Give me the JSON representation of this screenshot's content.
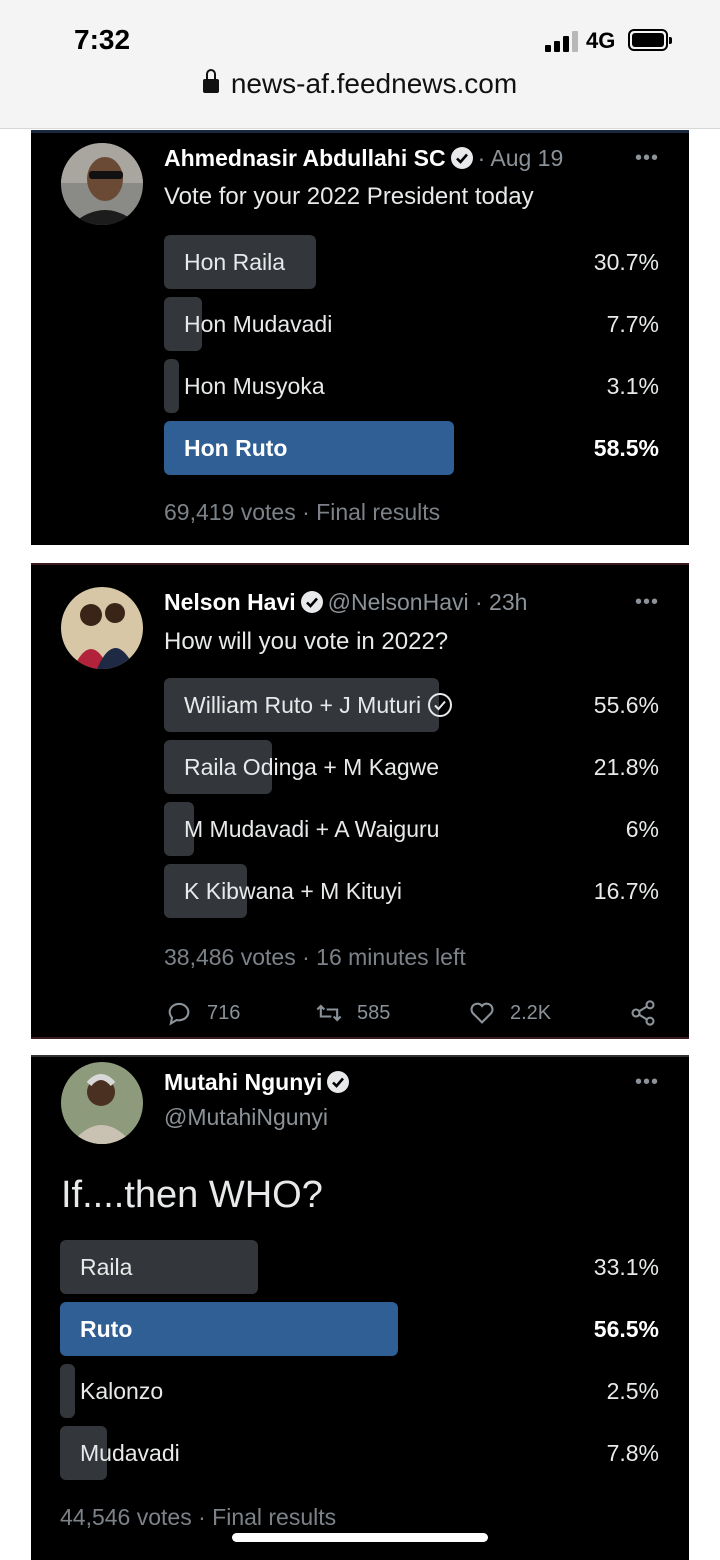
{
  "status_bar": {
    "time": "7:32",
    "network": "4G",
    "url": "news-af.feednews.com"
  },
  "icons": {
    "lock": "lock-icon",
    "verified": "verified-badge-icon",
    "more": "more-options-icon",
    "reply": "reply-icon",
    "retweet": "retweet-icon",
    "like": "heart-icon",
    "share": "share-icon",
    "check": "check-circle-icon"
  },
  "colors": {
    "winner_bar": "#2f5f94",
    "bar": "#33373b",
    "card_bg": "#000000"
  },
  "poll1": {
    "author": "Ahmednasir Abdullahi SC",
    "meta": "· Aug 19",
    "question": "Vote for your 2022 President today",
    "options": [
      {
        "label": "Hon Raila",
        "percent": "30.7%",
        "share": 0.307,
        "winner": false
      },
      {
        "label": "Hon Mudavadi",
        "percent": "7.7%",
        "share": 0.077,
        "winner": false
      },
      {
        "label": "Hon Musyoka",
        "percent": "3.1%",
        "share": 0.031,
        "winner": false
      },
      {
        "label": "Hon Ruto",
        "percent": "58.5%",
        "share": 0.585,
        "winner": true
      }
    ],
    "votes": "69,419 votes",
    "status": "· Final results"
  },
  "poll2": {
    "author": "Nelson Havi",
    "handle": "@NelsonHavi · 23h",
    "question": "How will you vote in 2022?",
    "options": [
      {
        "label": "William Ruto + J Muturi",
        "percent": "55.6%",
        "share": 0.556,
        "selected": true
      },
      {
        "label": "Raila Odinga + M Kagwe",
        "percent": "21.8%",
        "share": 0.218
      },
      {
        "label": "M Mudavadi + A Waiguru",
        "percent": "6%",
        "share": 0.06
      },
      {
        "label": "K Kibwana + M Kituyi",
        "percent": "16.7%",
        "share": 0.167
      }
    ],
    "votes": "38,486 votes",
    "status": "· 16 minutes left",
    "actions": {
      "replies": "716",
      "retweets": "585",
      "likes": "2.2K"
    }
  },
  "poll3": {
    "author": "Mutahi Ngunyi",
    "handle": "@MutahiNgunyi",
    "question": "If....then WHO?",
    "options": [
      {
        "label": "Raila",
        "percent": "33.1%",
        "share": 0.331,
        "winner": false
      },
      {
        "label": "Ruto",
        "percent": "56.5%",
        "share": 0.565,
        "winner": true
      },
      {
        "label": "Kalonzo",
        "percent": "2.5%",
        "share": 0.025,
        "winner": false
      },
      {
        "label": "Mudavadi",
        "percent": "7.8%",
        "share": 0.078,
        "winner": false
      }
    ],
    "votes": "44,546 votes",
    "status": "· Final results"
  }
}
